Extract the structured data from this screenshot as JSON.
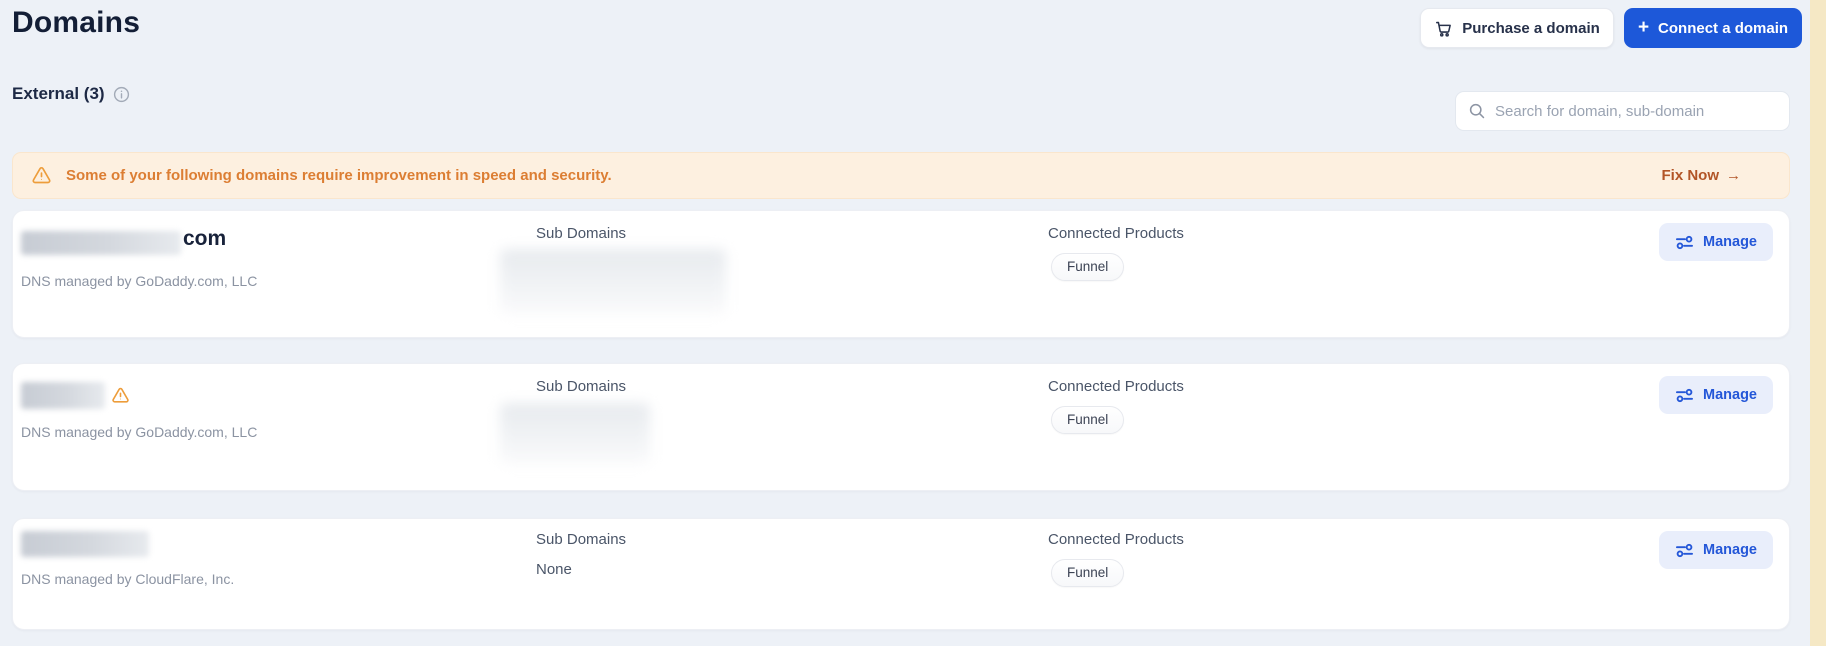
{
  "page": {
    "title": "Domains",
    "background": "#edf1f7",
    "accent_blue": "#1d58d9",
    "edge_strip_color": "#f5e8c5"
  },
  "header": {
    "purchase_label": "Purchase a domain",
    "connect_label": "Connect a domain",
    "plus_glyph": "+"
  },
  "section": {
    "label": "External (3)"
  },
  "search": {
    "placeholder": "Search for domain, sub-domain"
  },
  "banner": {
    "message": "Some of your following domains require improvement in speed and security.",
    "action_label": "Fix Now",
    "arrow": "→",
    "background": "#fdf0e0",
    "text_color": "#dc7e33",
    "action_color": "#b25527",
    "warning_color": "#ed9d3b"
  },
  "card_labels": {
    "subdomains_header": "Sub Domains",
    "connected_header": "Connected Products",
    "manage": "Manage"
  },
  "domains": [
    {
      "visible_name_suffix": "com",
      "name_redacted": true,
      "dns": "DNS managed by GoDaddy.com, LLC",
      "has_warning": false,
      "subdomains_redacted": true,
      "subdomains": "",
      "products": [
        "Funnel"
      ]
    },
    {
      "visible_name_suffix": "",
      "name_redacted": true,
      "dns": "DNS managed by GoDaddy.com, LLC",
      "has_warning": true,
      "subdomains_redacted": true,
      "subdomains": "",
      "products": [
        "Funnel"
      ]
    },
    {
      "visible_name_suffix": "",
      "name_redacted": true,
      "dns": "DNS managed by CloudFlare, Inc.",
      "has_warning": false,
      "subdomains_redacted": false,
      "subdomains": "None",
      "products": [
        "Funnel"
      ]
    }
  ]
}
